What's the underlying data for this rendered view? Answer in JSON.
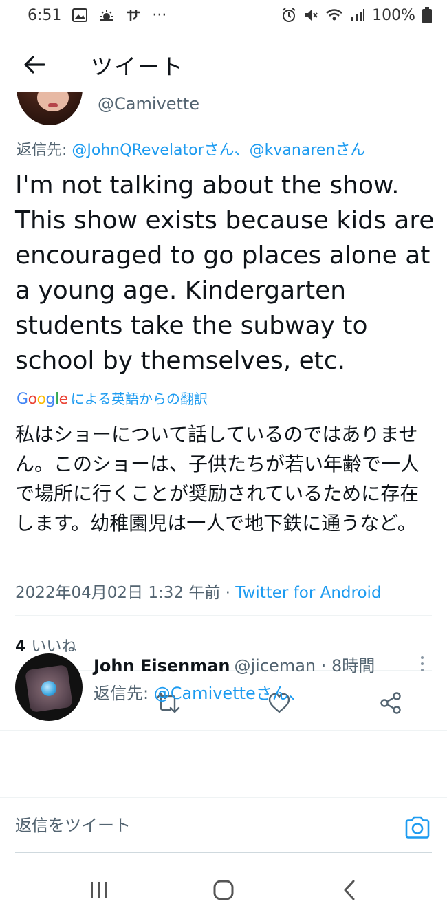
{
  "status_bar": {
    "time": "6:51",
    "dots": "···",
    "battery": "100%"
  },
  "app_bar": {
    "title": "ツイート"
  },
  "tweet": {
    "author_handle": "@Camivette",
    "reply_to_prefix": "返信先: ",
    "reply_to_users": "@JohnQRevelatorさん、@kvanarenさん",
    "text": "I'm not talking about the show. This show exists because kids are encouraged to go places alone at a young age. Kindergarten students take the subway to school by themselves, etc.",
    "translate": {
      "label": "による英語からの翻訳"
    },
    "translated_text": "私はショーについて話しているのではありません。このショーは、子供たちが若い年齢で一人で場所に行くことが奨励されているために存在します。幼稚園児は一人で地下鉄に通うなど。",
    "timestamp": "2022年04月02日 1:32 午前",
    "separator": " · ",
    "source": "Twitter for Android",
    "likes_count": "4",
    "likes_label": "いいね"
  },
  "reply": {
    "name": "John Eisenman",
    "handle": "@jiceman · 8時間",
    "reply_to_prefix": "返信先: ",
    "reply_to_user": "@Camivetteさん、"
  },
  "compose": {
    "placeholder": "返信をツイート"
  },
  "icons": {
    "back": "arrow-left-icon",
    "reply": "comment-icon",
    "retweet": "retweet-icon",
    "like": "heart-icon",
    "share": "share-icon",
    "camera": "camera-icon",
    "nav_recent": "recent-apps-icon",
    "nav_home": "home-icon",
    "nav_back": "chevron-left-icon"
  },
  "colors": {
    "link": "#1d9bf0",
    "text": "#0f1419",
    "secondary": "#536471"
  }
}
